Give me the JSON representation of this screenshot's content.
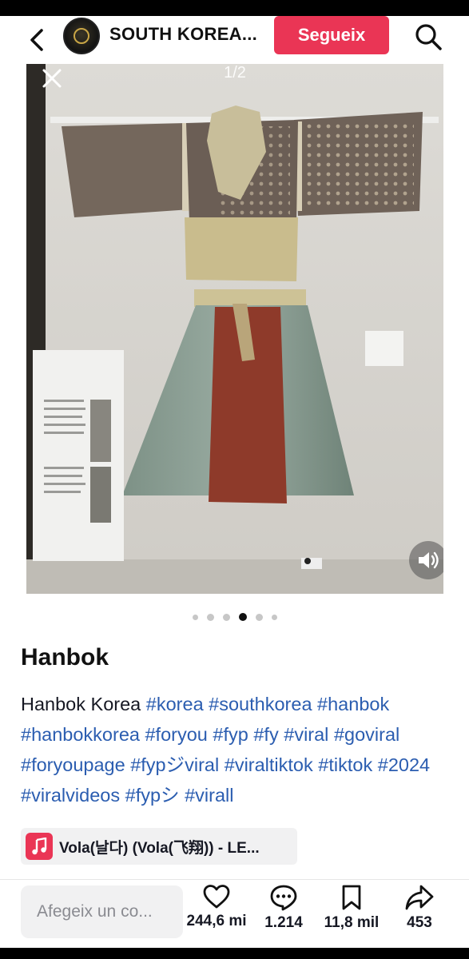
{
  "header": {
    "account_name": "SOUTH KOREA...",
    "follow_label": "Segueix",
    "avatar_icon": "account-avatar",
    "back_icon": "chevron-left-icon",
    "search_icon": "search-icon"
  },
  "media": {
    "page_counter": "1/2",
    "close_icon": "close-icon",
    "volume_icon": "speaker-icon",
    "carousel_dots": 6,
    "active_dot_index": 3
  },
  "post": {
    "title": "Hanbok",
    "caption_text": "Hanbok Korea",
    "hashtags": [
      "#korea",
      "#southkorea",
      "#hanbok",
      "#hanbokkorea",
      "#foryou",
      "#fyp",
      "#fy",
      "#viral",
      "#goviral",
      "#foryoupage",
      "#fypジviral",
      "#viraltiktok",
      "#tiktok",
      "#2024",
      "#viralvideos",
      "#fypシ",
      "#virall"
    ],
    "hashtag_color": "#2b5db0"
  },
  "sound": {
    "title": "Vola(날다) (Vola(飞翔)) - LE...",
    "icon": "music-note-icon"
  },
  "actions": {
    "comment_placeholder": "Afegeix un co...",
    "likes": "244,6 mi",
    "comments": "1.214",
    "saves": "11,8 mil",
    "shares": "453"
  },
  "colors": {
    "accent": "#ea3555",
    "link": "#2b5db0"
  }
}
